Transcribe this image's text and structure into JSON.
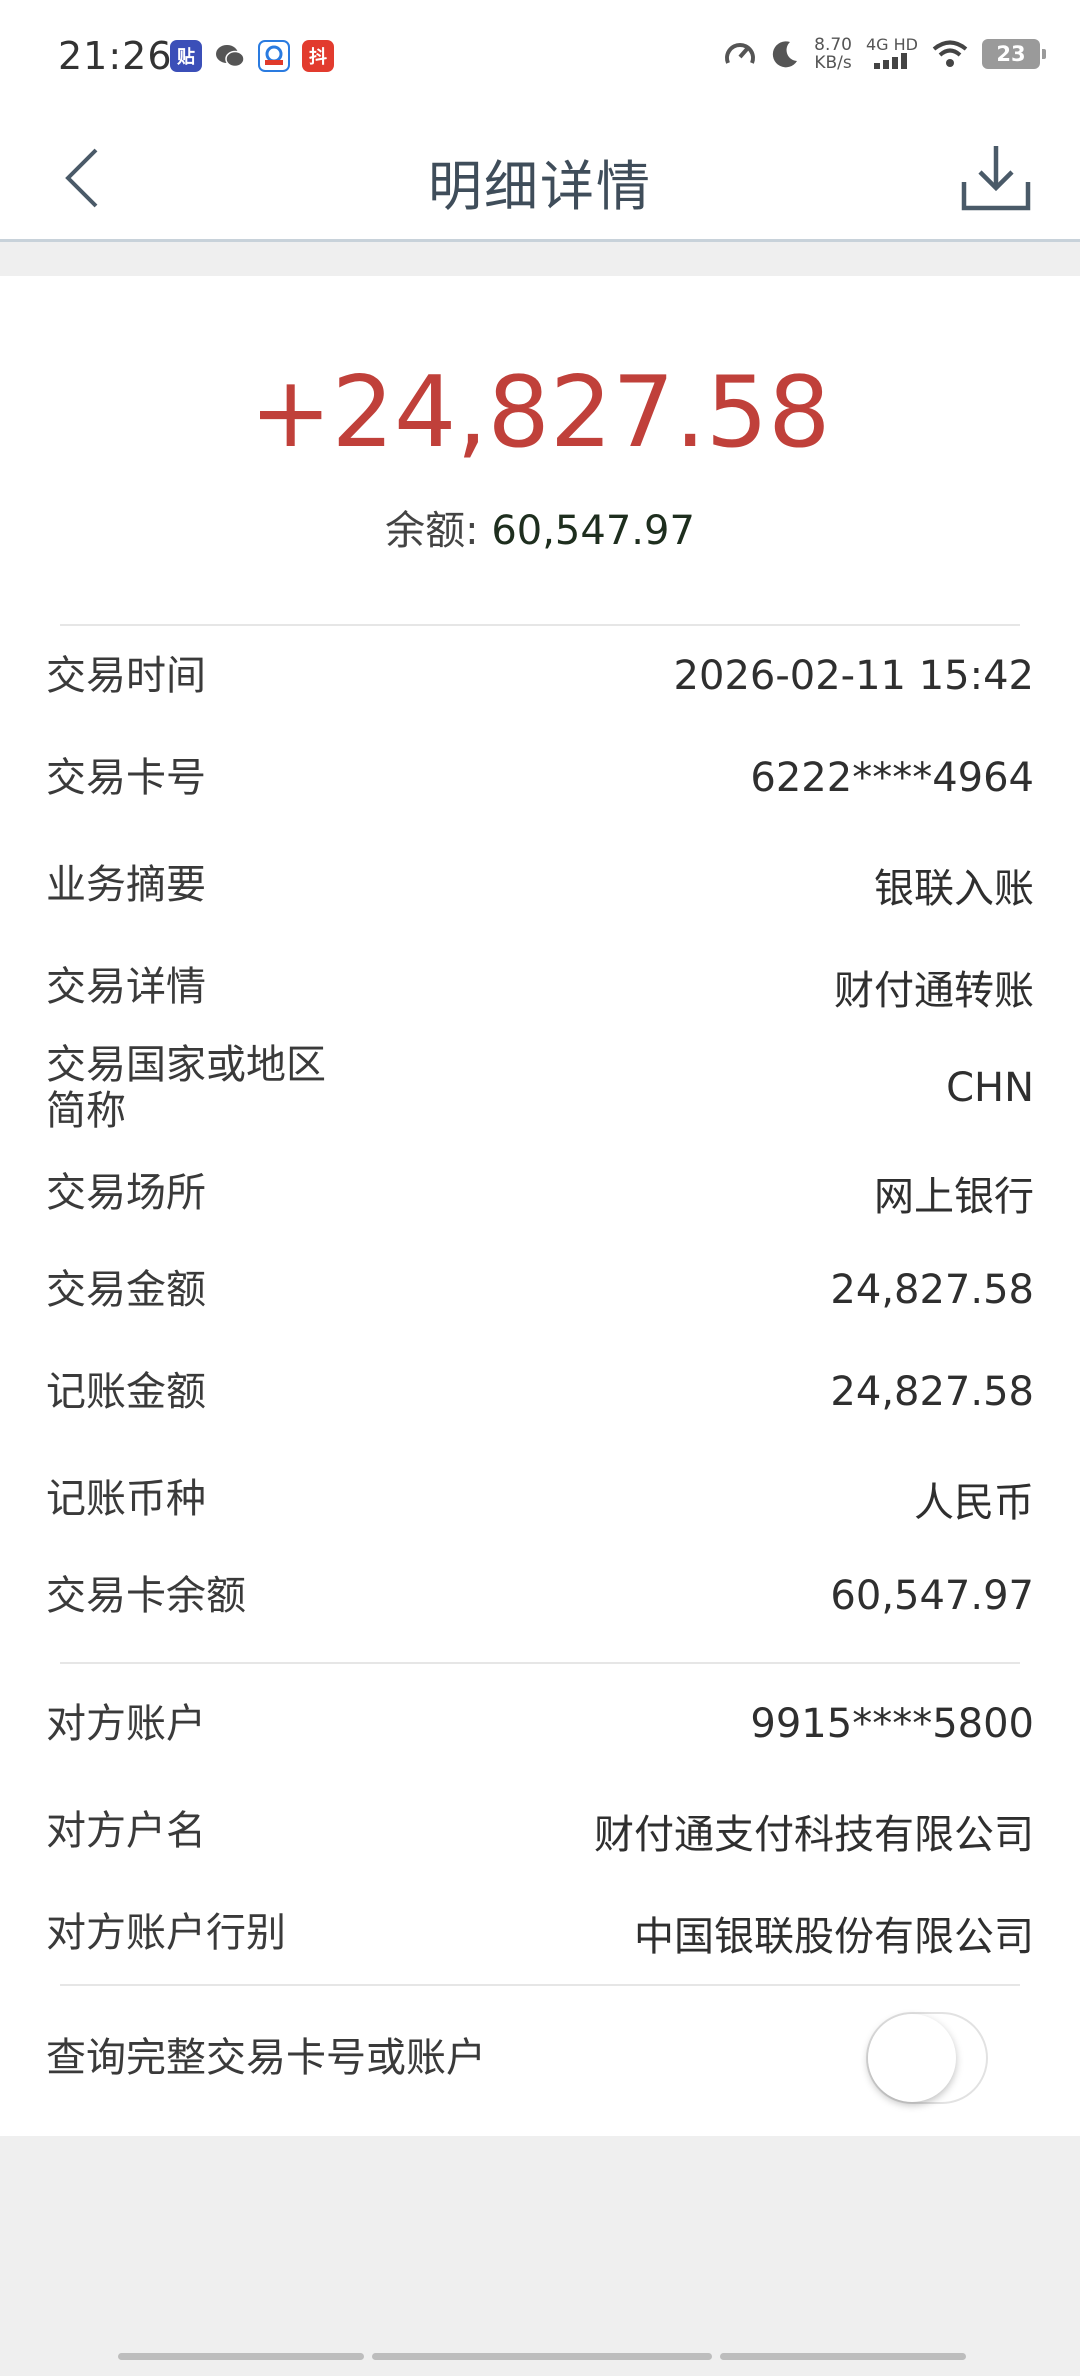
{
  "status_bar": {
    "time": "21:26",
    "speed_value": "8.70",
    "speed_unit": "KB/s",
    "network": "4G HD",
    "battery": "23"
  },
  "nav": {
    "title": "明细详情"
  },
  "summary": {
    "amount": "+24,827.58",
    "balance_label": "余额: ",
    "balance_value": "60,547.97"
  },
  "details": [
    {
      "label": "交易时间",
      "value": "2026-02-11 15:42"
    },
    {
      "label": "交易卡号",
      "value": "6222****4964"
    },
    {
      "label": "业务摘要",
      "value": "银联入账"
    },
    {
      "label": "交易详情",
      "value": "财付通转账"
    },
    {
      "label": "交易国家或地区\n简称",
      "value": "CHN"
    },
    {
      "label": "交易场所",
      "value": "网上银行"
    },
    {
      "label": "交易金额",
      "value": "24,827.58"
    },
    {
      "label": "记账金额",
      "value": "24,827.58"
    },
    {
      "label": "记账币种",
      "value": "人民币"
    },
    {
      "label": "交易卡余额",
      "value": "60,547.97"
    }
  ],
  "counterparty": [
    {
      "label": "对方账户",
      "value": "9915****5800"
    },
    {
      "label": "对方户名",
      "value": "财付通支付科技有限公司"
    },
    {
      "label": "对方账户行别",
      "value": "中国银联股份有限公司"
    }
  ],
  "toggle_row": {
    "label": "查询完整交易卡号或账户",
    "enabled": false
  },
  "colors": {
    "amount": "#c0403a",
    "title": "#3f4d5a",
    "nav_border": "#c8d2da"
  }
}
